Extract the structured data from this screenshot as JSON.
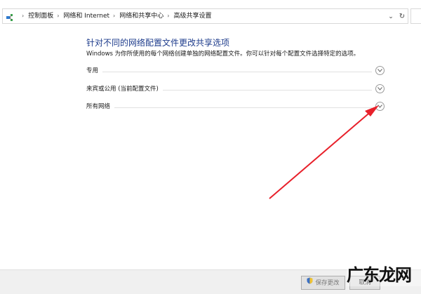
{
  "address_bar": {
    "icon": "network-icon",
    "crumbs": [
      "控制面板",
      "网络和 Internet",
      "网络和共享中心",
      "高级共享设置"
    ],
    "dropdown_icon": "chevron-down-icon",
    "refresh_icon": "refresh-icon"
  },
  "main": {
    "title": "针对不同的网络配置文件更改共享选项",
    "description": "Windows 为你所使用的每个网络创建单独的网络配置文件。你可以针对每个配置文件选择特定的选项。",
    "sections": [
      {
        "label": "专用"
      },
      {
        "label": "来宾或公用 (当前配置文件)"
      },
      {
        "label": "所有网络"
      }
    ]
  },
  "footer": {
    "save_label": "保存更改",
    "cancel_label": "取消"
  },
  "annotation": {
    "arrow_color": "#e8202a"
  },
  "watermark": {
    "text": "广东龙网"
  },
  "colors": {
    "title": "#1e3c8c",
    "footer_bg": "#f0f0f0"
  }
}
